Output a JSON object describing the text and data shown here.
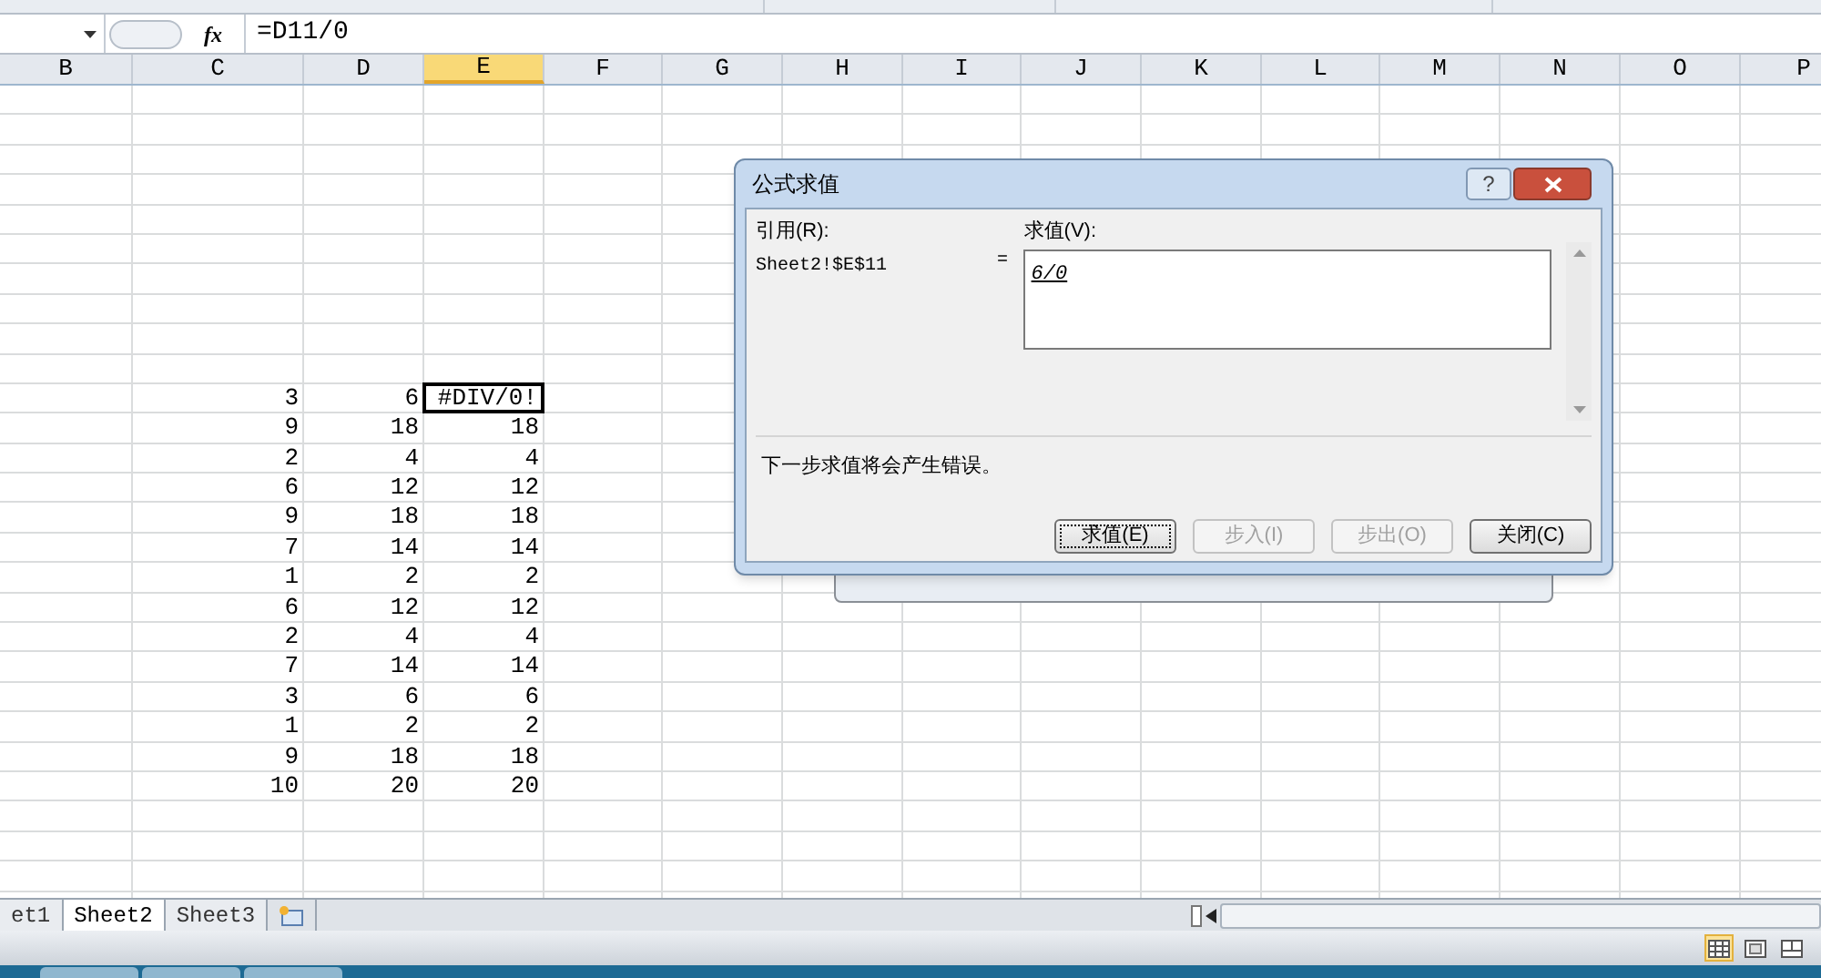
{
  "formula_bar": {
    "function_label": "fx",
    "formula": "=D11/0"
  },
  "columns": [
    {
      "label": "B",
      "selected": false
    },
    {
      "label": "C",
      "selected": false
    },
    {
      "label": "D",
      "selected": false
    },
    {
      "label": "E",
      "selected": true
    },
    {
      "label": "F",
      "selected": false
    },
    {
      "label": "G",
      "selected": false
    },
    {
      "label": "H",
      "selected": false
    },
    {
      "label": "I",
      "selected": false
    },
    {
      "label": "J",
      "selected": false
    },
    {
      "label": "K",
      "selected": false
    },
    {
      "label": "L",
      "selected": false
    },
    {
      "label": "M",
      "selected": false
    },
    {
      "label": "N",
      "selected": false
    },
    {
      "label": "O",
      "selected": false
    },
    {
      "label": "P",
      "selected": false
    }
  ],
  "rows": [
    {
      "c": "3",
      "d": "6",
      "e": "#DIV/0!",
      "selected": true
    },
    {
      "c": "9",
      "d": "18",
      "e": "18",
      "selected": false
    },
    {
      "c": "2",
      "d": "4",
      "e": "4",
      "selected": false
    },
    {
      "c": "6",
      "d": "12",
      "e": "12",
      "selected": false
    },
    {
      "c": "9",
      "d": "18",
      "e": "18",
      "selected": false
    },
    {
      "c": "7",
      "d": "14",
      "e": "14",
      "selected": false
    },
    {
      "c": "1",
      "d": "2",
      "e": "2",
      "selected": false
    },
    {
      "c": "6",
      "d": "12",
      "e": "12",
      "selected": false
    },
    {
      "c": "2",
      "d": "4",
      "e": "4",
      "selected": false
    },
    {
      "c": "7",
      "d": "14",
      "e": "14",
      "selected": false
    },
    {
      "c": "3",
      "d": "6",
      "e": "6",
      "selected": false
    },
    {
      "c": "1",
      "d": "2",
      "e": "2",
      "selected": false
    },
    {
      "c": "9",
      "d": "18",
      "e": "18",
      "selected": false
    },
    {
      "c": "10",
      "d": "20",
      "e": "20",
      "selected": false
    }
  ],
  "dialog": {
    "title": "公式求值",
    "help": "?",
    "reference_label": "引用(R):",
    "reference": "Sheet2!$E$11",
    "equals": "=",
    "value_label": "求值(V):",
    "value": "6/0",
    "message": "下一步求值将会产生错误。",
    "buttons": [
      {
        "label": "求值(E)",
        "disabled": false,
        "focused": true
      },
      {
        "label": "步入(I)",
        "disabled": true,
        "focused": false
      },
      {
        "label": "步出(O)",
        "disabled": true,
        "focused": false
      },
      {
        "label": "关闭(C)",
        "disabled": false,
        "focused": false
      }
    ]
  },
  "sheet_tabs": [
    {
      "label": "et1",
      "selected": false
    },
    {
      "label": "Sheet2",
      "selected": true
    },
    {
      "label": "Sheet3",
      "selected": false
    }
  ],
  "view_buttons": [
    {
      "kind": "normal",
      "selected": true
    },
    {
      "kind": "page_layout",
      "selected": false
    },
    {
      "kind": "page_break",
      "selected": false
    }
  ]
}
